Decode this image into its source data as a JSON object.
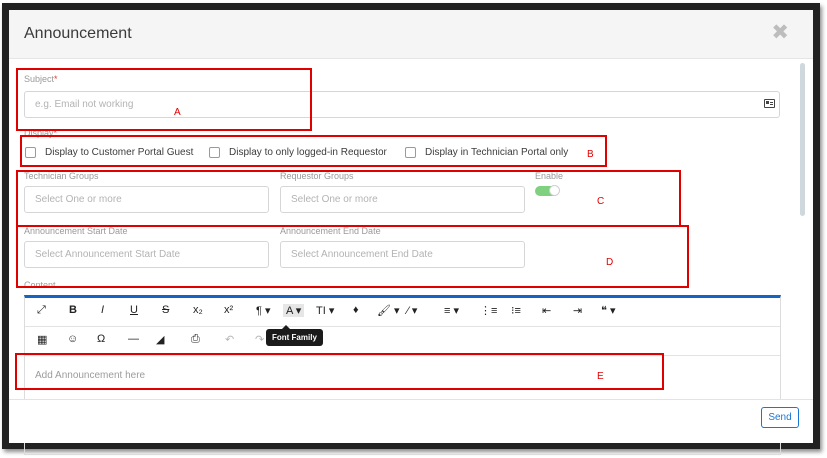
{
  "dialog": {
    "title": "Announcement",
    "close_glyph": "✖"
  },
  "form": {
    "subject": {
      "label": "Subject",
      "required_mark": "*",
      "placeholder": "e.g. Email not working"
    },
    "display": {
      "label": "Display",
      "required_mark": "*",
      "options": [
        "Display to Customer Portal Guest",
        "Display to only logged-in Requestor",
        "Display in Technician Portal only"
      ]
    },
    "technician_groups": {
      "label": "Technician Groups",
      "placeholder": "Select One or more"
    },
    "requestor_groups": {
      "label": "Requestor Groups",
      "placeholder": "Select One or more"
    },
    "enable": {
      "label": "Enable",
      "on": true
    },
    "start_date": {
      "label": "Announcement Start Date",
      "placeholder": "Select Announcement Start Date"
    },
    "end_date": {
      "label": "Announcement End Date",
      "placeholder": "Select Announcement End Date"
    },
    "content": {
      "label": "Content",
      "placeholder": "Add Announcement here"
    }
  },
  "editor": {
    "row1": [
      "⤢",
      "B",
      "I",
      "U",
      "S",
      "x₂",
      "x²",
      "¶ ▾",
      "A ▾",
      "TI ▾",
      "♦",
      "🖌 ▾",
      "⁄ ▾",
      "≡ ▾",
      "⋮≡",
      "⁝≡",
      "⇤",
      "⇥",
      "❝ ▾"
    ],
    "row2": [
      "▦",
      "☺",
      "Ω",
      "—",
      "◢",
      "⎙",
      "↶",
      "↷"
    ],
    "tooltip": "Font Family"
  },
  "footer": {
    "send_label": "Send"
  },
  "annotations": [
    "A",
    "B",
    "C",
    "D",
    "E"
  ],
  "colors": {
    "accent": "#1976d2",
    "toolbar_rule": "#1565c0",
    "annotation": "#e00000",
    "toggle_on": "#7fd07f"
  }
}
